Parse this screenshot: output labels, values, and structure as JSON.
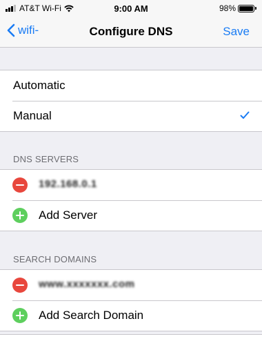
{
  "status_bar": {
    "carrier": "AT&T Wi-Fi",
    "time": "9:00 AM",
    "battery_percent": "98%",
    "battery_level": 0.98
  },
  "nav": {
    "back_label": "wifi-",
    "title": "Configure DNS",
    "save_label": "Save"
  },
  "mode": {
    "options": [
      "Automatic",
      "Manual"
    ],
    "selected": "Manual"
  },
  "dns_servers": {
    "header": "DNS SERVERS",
    "items": [
      "192.168.0.1"
    ],
    "add_label": "Add Server"
  },
  "search_domains": {
    "header": "SEARCH DOMAINS",
    "items": [
      "www.xxxxxxx.com"
    ],
    "add_label": "Add Search Domain"
  },
  "colors": {
    "accent": "#1a7cf4",
    "remove": "#e8473d",
    "add": "#5ecf5e",
    "background": "#efeff4"
  }
}
